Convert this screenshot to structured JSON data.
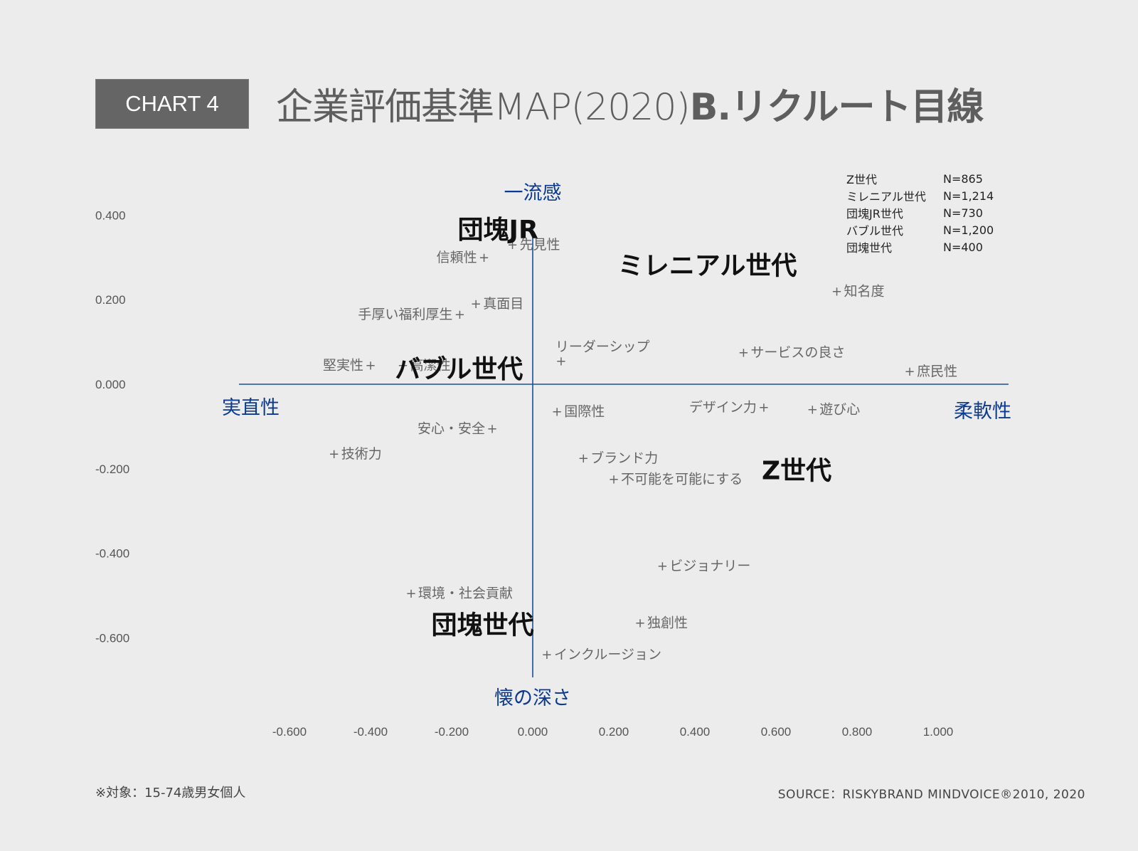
{
  "header": {
    "badge": "CHART 4",
    "title_main": "企業評価基準MAP(2020)",
    "title_bold": "B.リクルート目線"
  },
  "legend": [
    {
      "group": "Z世代",
      "n": "N=865"
    },
    {
      "group": "ミレニアル世代",
      "n": "N=1,214"
    },
    {
      "group": "団塊JR世代",
      "n": "N=730"
    },
    {
      "group": "バブル世代",
      "n": "N=1,200"
    },
    {
      "group": "団塊世代",
      "n": "N=400"
    }
  ],
  "footer": {
    "note": "※対象：15-74歳男女個人",
    "source": "SOURCE：RISKYBRAND MINDVOICE®2010, 2020"
  },
  "colors": {
    "axis": "#1a4f9c",
    "axis_label": "#0b3a8f",
    "attribute_text": "#666666",
    "generation_text": "#111111",
    "tick_text": "#555555",
    "background": "#ececec"
  },
  "chart_data": {
    "type": "scatter",
    "title": "企業評価基準MAP(2020) B.リクルート目線",
    "xlim": [
      -0.7,
      1.15
    ],
    "ylim": [
      -0.72,
      0.4
    ],
    "xticks": [
      "-0.600",
      "-0.400",
      "-0.200",
      "0.000",
      "0.200",
      "0.400",
      "0.600",
      "0.800",
      "1.000"
    ],
    "xtick_values": [
      -0.6,
      -0.4,
      -0.2,
      0.0,
      0.2,
      0.4,
      0.6,
      0.8,
      1.0
    ],
    "yticks": [
      "0.400",
      "0.200",
      "0.000",
      "-0.200",
      "-0.400",
      "-0.600"
    ],
    "ytick_values": [
      0.4,
      0.2,
      0.0,
      -0.2,
      -0.4,
      -0.6
    ],
    "grid": false,
    "axis_labels": {
      "top": "一流感",
      "bottom": "懐の深さ",
      "left": "実直性",
      "right": "柔軟性"
    },
    "attributes": [
      {
        "label": "先見性",
        "x": -0.05,
        "y": 0.33,
        "side": "right"
      },
      {
        "label": "信頼性",
        "x": -0.12,
        "y": 0.3,
        "side": "left"
      },
      {
        "label": "真面目",
        "x": -0.14,
        "y": 0.19,
        "side": "right"
      },
      {
        "label": "手厚い福利厚生",
        "x": -0.18,
        "y": 0.165,
        "side": "left"
      },
      {
        "label": "知名度",
        "x": 0.75,
        "y": 0.22,
        "side": "right"
      },
      {
        "label": "リーダーシップ",
        "x": 0.07,
        "y": 0.055,
        "side": "above"
      },
      {
        "label": "サービスの良さ",
        "x": 0.52,
        "y": 0.075,
        "side": "right"
      },
      {
        "label": "庶民性",
        "x": 0.93,
        "y": 0.03,
        "side": "right"
      },
      {
        "label": "堅実性",
        "x": -0.4,
        "y": 0.045,
        "side": "left"
      },
      {
        "label": "高潔性",
        "x": -0.32,
        "y": 0.045,
        "side": "right"
      },
      {
        "label": "国際性",
        "x": 0.06,
        "y": -0.065,
        "side": "right"
      },
      {
        "label": "デザイン力",
        "x": 0.57,
        "y": -0.055,
        "side": "left"
      },
      {
        "label": "遊び心",
        "x": 0.69,
        "y": -0.06,
        "side": "right"
      },
      {
        "label": "安心・安全",
        "x": -0.1,
        "y": -0.105,
        "side": "left"
      },
      {
        "label": "技術力",
        "x": -0.49,
        "y": -0.165,
        "side": "right"
      },
      {
        "label": "ブランド力",
        "x": 0.125,
        "y": -0.175,
        "side": "right"
      },
      {
        "label": "不可能を可能にする",
        "x": 0.2,
        "y": -0.225,
        "side": "right"
      },
      {
        "label": "ビジョナリー",
        "x": 0.32,
        "y": -0.43,
        "side": "right"
      },
      {
        "label": "環境・社会貢献",
        "x": -0.3,
        "y": -0.495,
        "side": "right"
      },
      {
        "label": "独創性",
        "x": 0.265,
        "y": -0.565,
        "side": "right"
      },
      {
        "label": "インクルージョン",
        "x": 0.035,
        "y": -0.64,
        "side": "right"
      }
    ],
    "generations": [
      {
        "label": "団塊JR",
        "x": -0.185,
        "y": 0.345
      },
      {
        "label": "ミレニアル世代",
        "x": 0.21,
        "y": 0.26
      },
      {
        "label": "バブル世代",
        "x": -0.34,
        "y": 0.015
      },
      {
        "label": "Z世代",
        "x": 0.565,
        "y": -0.225
      },
      {
        "label": "団塊世代",
        "x": -0.25,
        "y": -0.59
      }
    ]
  }
}
